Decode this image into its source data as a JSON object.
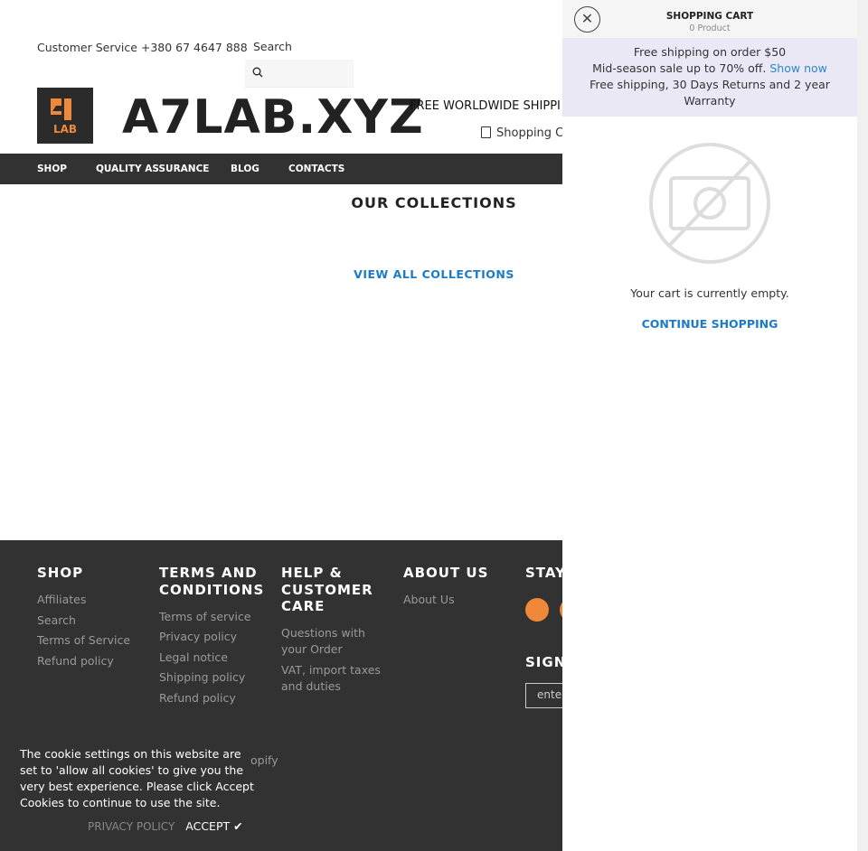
{
  "header": {
    "customer_service": "Customer Service +380 67 4647 888",
    "search_label": "Search",
    "brand": "A7LAB.XYZ",
    "logo_text": "LAB",
    "shipping_banner": "FREE WORLDWIDE SHIPPI",
    "cart_link": "Shopping Ca"
  },
  "nav": [
    "SHOP",
    "QUALITY ASSURANCE",
    "BLOG",
    "CONTACTS"
  ],
  "main": {
    "collections_title": "OUR COLLECTIONS",
    "view_all": "VIEW ALL COLLECTIONS"
  },
  "footer": {
    "shop": {
      "title": "SHOP",
      "links": [
        "Affiliates",
        "Search",
        "Terms of Service",
        "Refund policy"
      ]
    },
    "terms": {
      "title": "TERMS AND CONDITIONS",
      "links": [
        "Terms of service",
        "Privacy policy",
        "Legal notice",
        "Shipping policy",
        "Refund policy"
      ]
    },
    "help": {
      "title": "HELP & CUSTOMER CARE",
      "links": [
        "Questions with your Order",
        "VAT, import taxes and duties"
      ]
    },
    "about": {
      "title": "ABOUT US",
      "links": [
        "About Us"
      ]
    },
    "stay": "STAY",
    "sign": "SIGN",
    "email_placeholder": "enter",
    "powered": "opify"
  },
  "cookie": {
    "text": "The cookie settings on this website are set to 'allow all cookies' to give you the very best experience. Please click Accept Cookies to continue to use the site.",
    "privacy": "PRIVACY POLICY",
    "accept": "ACCEPT ✔"
  },
  "cart": {
    "title": "SHOPPING CART",
    "count": "0 Product",
    "promo1": "Free shipping on order $50",
    "promo2": "Mid-season sale up to 70% off.",
    "promo_link": "Show now",
    "promo3": "Free shipping, 30 Days Returns and 2 year Warranty",
    "empty": "Your cart is currently empty.",
    "continue": "CONTINUE SHOPPING"
  },
  "colors": {
    "accent": "#1a7bc9",
    "dark": "#333232",
    "orange": "#f0883a"
  }
}
